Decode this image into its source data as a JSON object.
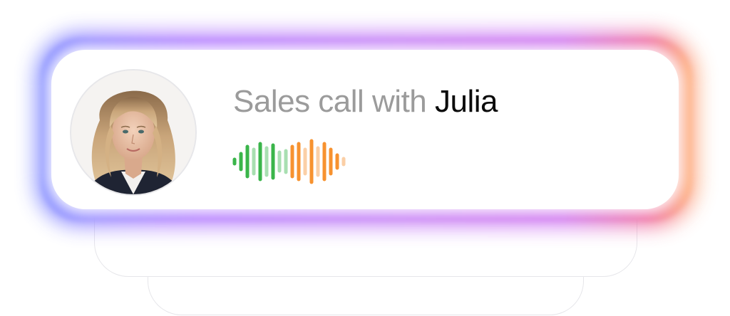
{
  "call": {
    "title_prefix": "Sales call with ",
    "contact_name": "Julia"
  },
  "avatar": {
    "icon": "person-photo"
  },
  "waveform": {
    "speaker_color": "#3ab54a",
    "speaker_light_color": "#a8dfb1",
    "listener_color": "#f7922f",
    "listener_light_color": "#fbcfa6"
  },
  "colors": {
    "glow_start": "#7f8bff",
    "glow_mid": "#c27bf7",
    "glow_end": "#ffb37a"
  }
}
